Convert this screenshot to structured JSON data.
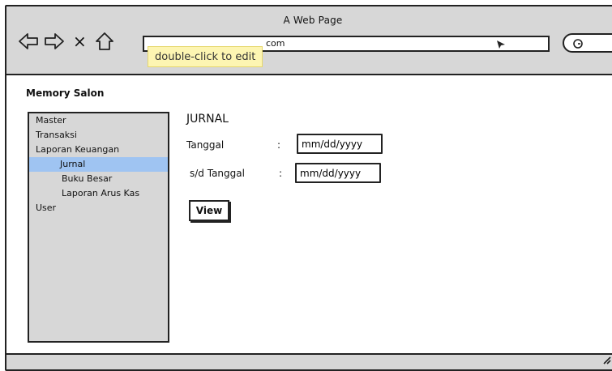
{
  "window": {
    "title": "A Web Page"
  },
  "address_bar": {
    "url": "com"
  },
  "tooltip": {
    "text": "double-click to edit"
  },
  "app": {
    "title": "Memory Salon"
  },
  "sidebar": {
    "items": [
      {
        "label": "Master"
      },
      {
        "label": "Transaksi"
      },
      {
        "label": "Laporan Keuangan"
      },
      {
        "label": "Jurnal",
        "active": true
      },
      {
        "label": "Buku Besar"
      },
      {
        "label": "Laporan Arus Kas"
      },
      {
        "label": "User"
      }
    ]
  },
  "main": {
    "title": "JURNAL",
    "fields": [
      {
        "label": "Tanggal",
        "separator": ":",
        "value": "mm/dd/yyyy"
      },
      {
        "label": "s/d Tanggal",
        "separator": ":",
        "value": "mm/dd/yyyy"
      }
    ],
    "view_button": "View"
  },
  "colors": {
    "chrome": "#d7d7d7",
    "active_item": "#9fc4f2",
    "tooltip_bg": "#fdf5b2"
  },
  "icons": [
    "back-arrow-icon",
    "forward-arrow-icon",
    "close-icon",
    "home-icon",
    "cursor-icon",
    "search-icon",
    "resize-grip-icon"
  ]
}
